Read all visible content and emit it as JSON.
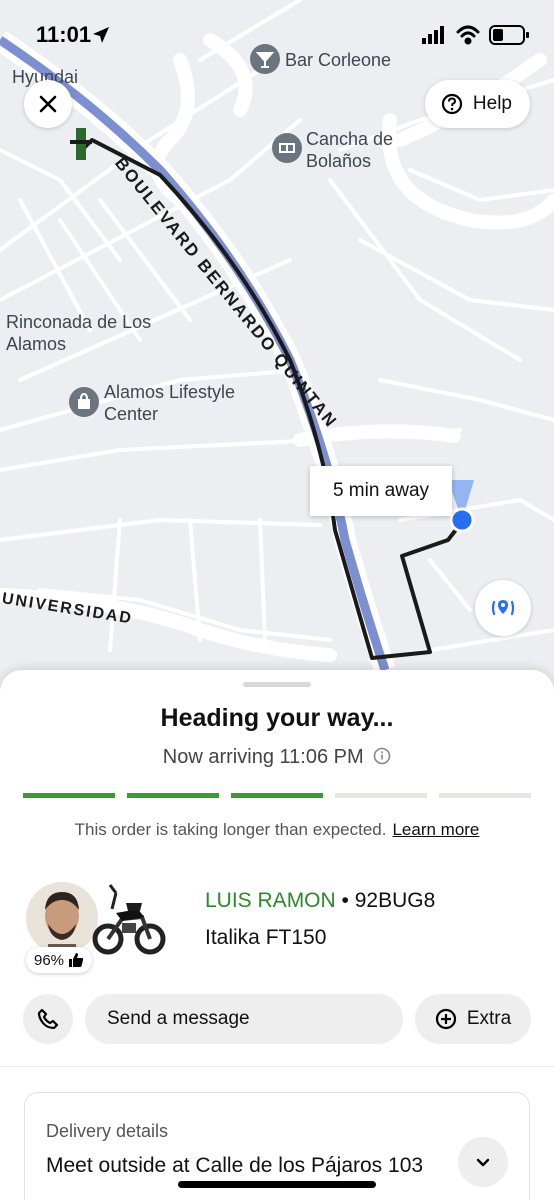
{
  "status_bar": {
    "time": "11:01"
  },
  "map": {
    "labels": {
      "hyundai": "Hyundai",
      "bar_corleone": "Bar Corleone",
      "cancha_line1": "Cancha de",
      "cancha_line2": "Bolaños",
      "rinconada_line1": "Rinconada de Los",
      "rinconada_line2": "Alamos",
      "alamos_line1": "Alamos Lifestyle",
      "alamos_line2": "Center",
      "boulevard": "BOULEVARD BERNARDO QUINTAN",
      "universidad": "UNIVERSIDAD"
    },
    "eta": "5 min away",
    "help_label": "Help",
    "route_color": "#1a1a1a",
    "road_highlight_color": "#7b8fd1",
    "courier_dot_color": "#276ef1"
  },
  "sheet": {
    "title": "Heading your way...",
    "arrival": "Now arriving 11:06 PM",
    "progress": {
      "total_segments": 5,
      "completed_segments": 3,
      "done_color": "#3a9b36",
      "todo_color": "#e7e7e2"
    },
    "notice": "This order is taking longer than expected.",
    "notice_link": "Learn more",
    "driver": {
      "name": "LUIS RAMON",
      "separator": " • ",
      "plate": "92BUG8",
      "vehicle": "Italika FT150",
      "rating": "96%"
    },
    "actions": {
      "message": "Send a message",
      "extra": "Extra"
    },
    "delivery": {
      "label": "Delivery details",
      "value": "Meet outside at Calle de los Pájaros 103"
    }
  }
}
